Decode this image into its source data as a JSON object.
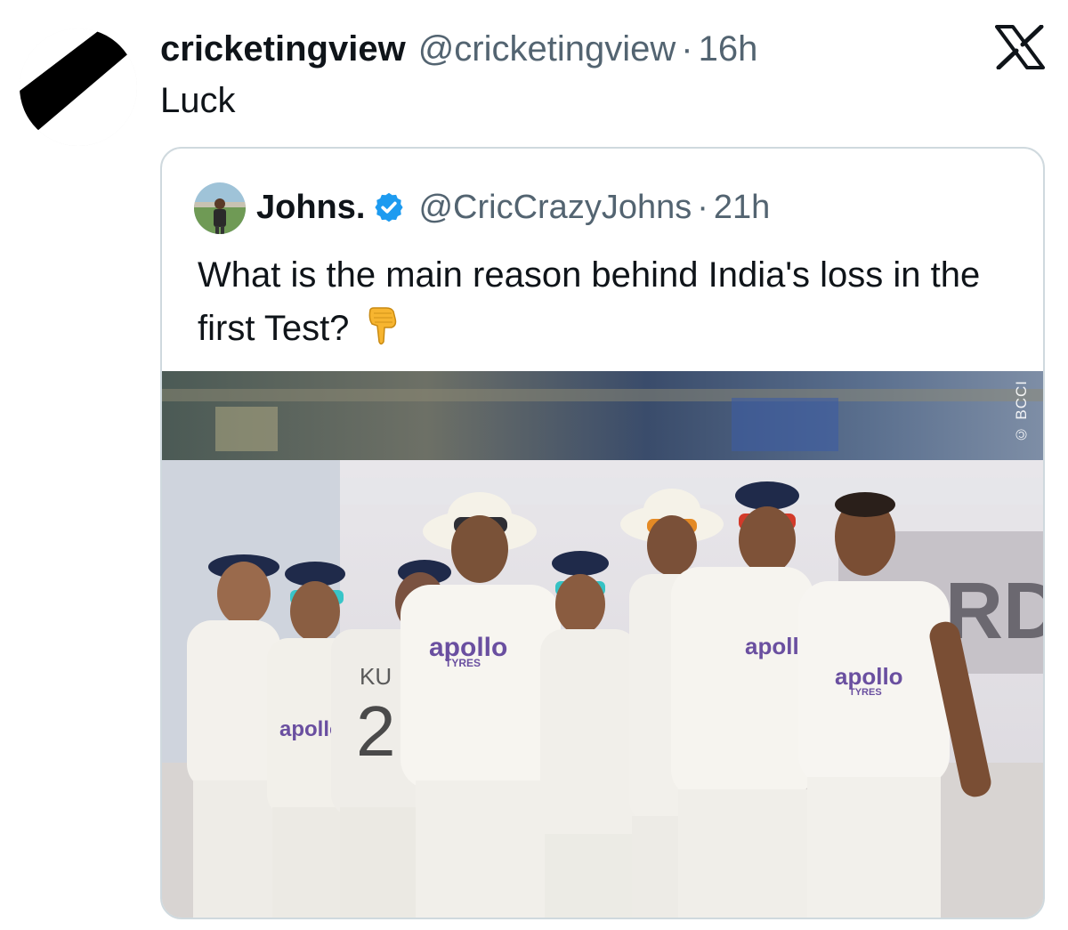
{
  "tweet": {
    "display_name": "cricketingview",
    "handle": "@cricketingview",
    "separator": "·",
    "time": "16h",
    "text": "Luck",
    "avatar_icon": "black-white-diagonal-avatar",
    "platform_icon": "x-logo-icon"
  },
  "quoted_tweet": {
    "display_name": "Johns.",
    "verified": true,
    "verified_color": "#1d9bf0",
    "handle": "@CricCrazyJohns",
    "separator": "·",
    "time": "21h",
    "text": "What is the main reason behind India's loss in the first Test?",
    "emoji": "backhand-index-pointing-down",
    "media": {
      "type": "photo",
      "description_icon": "cricket-team-photo",
      "watermark": "© BCCI",
      "jersey_sponsor": "apollo",
      "jersey_sponsor_sub": "TYRES",
      "jersey_name_fragment": "KU",
      "jersey_number_fragment": "2",
      "board_text": "RD"
    }
  },
  "colors": {
    "text_primary": "#0f1419",
    "text_secondary": "#536471",
    "card_border": "#cfd9de",
    "sponsor_purple": "#6a4fa0"
  }
}
